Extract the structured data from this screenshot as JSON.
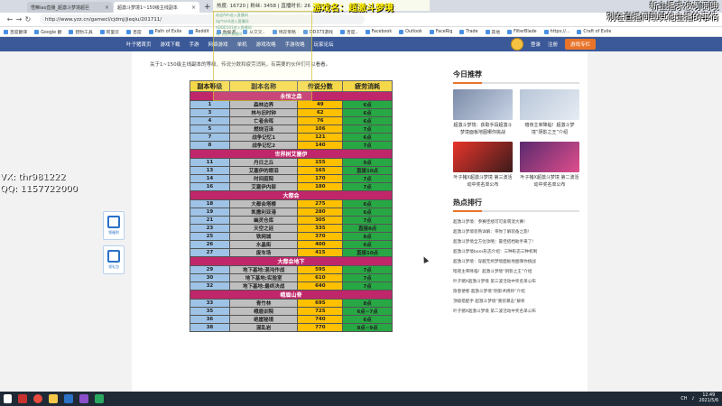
{
  "browser": {
    "tabs": [
      {
        "label": "悟嘛iao直播_超激斗梦境超巨"
      },
      {
        "label": "超激斗梦境1~150级主线副本"
      }
    ],
    "new_tab": "+",
    "url": "http://www.yzz.cn/gamecl/cjdmj/jieqiu/201711/",
    "bookmarks": [
      "百度翻译",
      "Google 翻",
      "猎豹工具",
      "阿里云",
      "百度",
      "Path of Exile",
      "Reddit",
      "数据源",
      "从交叉..",
      "博弈策略",
      "DD373游戏",
      "百度..",
      "Facebook",
      "Outlook",
      "FaceRig",
      "Trade",
      "其他",
      "FilterBlade",
      "https://...",
      "Craft of Exile"
    ]
  },
  "site_nav": {
    "items": [
      "叶子猪首页",
      "游戏下载",
      "手游",
      "网络游戏",
      "单机",
      "游戏攻略",
      "手游攻略",
      "玩家论坛"
    ],
    "login": "登录",
    "register": "注册",
    "download_btn": "游戏专栏"
  },
  "article": {
    "intro": "关于1~150级主线副本的等级、传说分数和疲劳消耗，有需要的伙伴们可以看看。",
    "table": {
      "headers": [
        "副本等级",
        "副本名称",
        "传说分数",
        "疲劳消耗"
      ],
      "rows": [
        {
          "section": "永恒之森"
        },
        {
          "cells": [
            "1",
            "森林边界",
            "49",
            "6点"
          ]
        },
        {
          "cells": [
            "3",
            "林与旧时钟",
            "62",
            "6点"
          ]
        },
        {
          "cells": [
            "4",
            "亡者余晖",
            "76",
            "6点"
          ]
        },
        {
          "cells": [
            "5",
            "燃烧沼泽",
            "106",
            "7点"
          ]
        },
        {
          "cells": [
            "7",
            "战争记忆1",
            "121",
            "6点"
          ]
        },
        {
          "cells": [
            "8",
            "战争记忆2",
            "140",
            "7点"
          ]
        },
        {
          "section": "世界树艾塞伊"
        },
        {
          "cells": [
            "11",
            "丹日之丘",
            "155",
            "9点"
          ]
        },
        {
          "cells": [
            "13",
            "艾塞伊的眼泪",
            "165",
            "直接10点"
          ]
        },
        {
          "cells": [
            "14",
            "时间庭院",
            "170",
            "7点"
          ]
        },
        {
          "cells": [
            "16",
            "艾塞伊内部",
            "180",
            "7点"
          ]
        },
        {
          "section": "大都会"
        },
        {
          "cells": [
            "18",
            "大都会塔楼",
            "275",
            "6点"
          ]
        },
        {
          "cells": [
            "19",
            "凯撒利亚港",
            "280",
            "6点"
          ]
        },
        {
          "cells": [
            "21",
            "幽灵仓库",
            "305",
            "7点"
          ]
        },
        {
          "cells": [
            "23",
            "天空之廷",
            "335",
            "直接8点"
          ]
        },
        {
          "cells": [
            "25",
            "铁网城",
            "370",
            "8点"
          ]
        },
        {
          "cells": [
            "26",
            "水晶街",
            "400",
            "6点"
          ]
        },
        {
          "cells": [
            "27",
            "废车场",
            "415",
            "直接10点"
          ]
        },
        {
          "section": "大都会地下"
        },
        {
          "cells": [
            "29",
            "地下基地:混沌作战",
            "595",
            "7点"
          ]
        },
        {
          "cells": [
            "30",
            "地下基地:实验室",
            "610",
            "7点"
          ]
        },
        {
          "cells": [
            "32",
            "地下基地:最终决战",
            "640",
            "7点"
          ]
        },
        {
          "section": "峨眉山脊"
        },
        {
          "cells": [
            "33",
            "青竹林",
            "695",
            "8点"
          ]
        },
        {
          "cells": [
            "35",
            "峨眉训院",
            "725",
            "6点~7点"
          ]
        },
        {
          "cells": [
            "36",
            "绝崖秘境",
            "740",
            "6点"
          ]
        },
        {
          "cells": [
            "38",
            "混乱岩",
            "770",
            "8点~9点"
          ]
        }
      ]
    }
  },
  "sidebar": {
    "recommend_title": "今日推荐",
    "recommend": [
      {
        "caption": "超激斗梦境：获取手段超激斗梦境面板地图哪你挑战"
      },
      {
        "caption": "暗夜主宰降临！超激斗梦境“阴影之王”介绍"
      },
      {
        "caption": "叶子猪X超激斗梦境 第三波活动中奖名单公布"
      },
      {
        "caption": "叶子猪X超激斗梦境 第二波活动中奖名单公布"
      }
    ],
    "hot_title": "热点排行",
    "hot": [
      "超激斗梦境：参赛佳绩可可爱萌宠大赛!",
      "超激斗梦境装熟详解：带你了解装备之旅!",
      "超激斗梦境全方位攻略：最佳搭档助手来了!",
      "超激斗梦境boss形态介绍：三种形态三种机制",
      "超激斗梦境：穿越无烬梦境面板地图哪你挑战",
      "暗夜主宰降临！超激斗梦境“阴影之王”介绍",
      "叶子猪X超激斗梦境 第三波活动中奖名单公布",
      "隐患便者 超激斗梦境“阴影术携师”介绍",
      "顶级搭配手 超激斗梦境“重装暴击”解析",
      "叶子猪X超激斗梦境 第二波活动中奖名单公布"
    ]
  },
  "float_buttons": [
    {
      "label": "领福利"
    },
    {
      "label": "领礼包"
    }
  ],
  "stream_overlay": {
    "stats": "热度: 16720 | 粉丝: 3458 | 直播时长: 26",
    "game_name": "游戏名：超激斗梦境",
    "right_line1": "新主播求波订阅哦",
    "right_line2": "别在直播间聊其他主播的事情",
    "wechat": "VX: thr981222",
    "wechat2": "QQ: 1157722000",
    "chat_lines": [
      "欢迎Ahh进入直播间",
      "dg*mmt进入直播间",
      "ADDD101进入直播间",
      "xy*y进入直播间"
    ]
  },
  "taskbar": {
    "time": "12:49",
    "date": "2021/5/6",
    "lang": "CH"
  }
}
